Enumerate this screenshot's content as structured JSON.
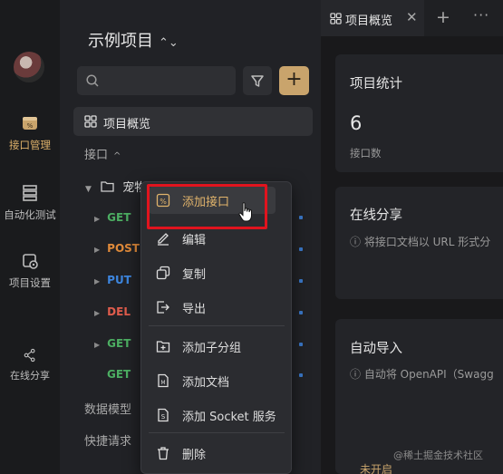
{
  "rail": {
    "items": [
      {
        "label": "接口管理",
        "icon": "api-management-icon",
        "active": true
      },
      {
        "label": "自动化测试",
        "icon": "automation-test-icon"
      },
      {
        "label": "项目设置",
        "icon": "project-settings-icon"
      },
      {
        "label": "在线分享",
        "icon": "share-icon"
      }
    ]
  },
  "sidebar": {
    "project_title": "示例项目",
    "overview_label": "项目概览",
    "section_api": "接口",
    "folder_name": "宠物",
    "apis": [
      {
        "method": "GET"
      },
      {
        "method": "POST"
      },
      {
        "method": "PUT"
      },
      {
        "method": "DEL"
      },
      {
        "method": "GET"
      },
      {
        "method": "GET"
      }
    ],
    "section_models": "数据模型",
    "section_quick": "快捷请求"
  },
  "tabs": {
    "active_tab": "项目概览",
    "plus": "+",
    "more": "···"
  },
  "main": {
    "stats_title": "项目统计",
    "api_count": "6",
    "api_count_label": "接口数",
    "share_title": "在线分享",
    "share_desc": "ⓘ 将接口文档以 URL 形式分",
    "import_title": "自动导入",
    "import_desc": "ⓘ 自动将 OpenAPI（Swagg",
    "status_badge": "未开启",
    "watermark": "@稀土掘金技术社区"
  },
  "context_menu": {
    "items": [
      {
        "label": "添加接口",
        "highlighted": true
      },
      {
        "label": "编辑"
      },
      {
        "label": "复制"
      },
      {
        "label": "导出"
      },
      {
        "label": "添加子分组"
      },
      {
        "label": "添加文档"
      },
      {
        "label": "添加 Socket 服务"
      },
      {
        "label": "删除"
      }
    ]
  },
  "colors": {
    "accent": "#c9a46c",
    "get": "#4cae62",
    "post": "#e08a3a",
    "put": "#3d86df",
    "del": "#e05c4c",
    "annotation": "#e0141e"
  }
}
